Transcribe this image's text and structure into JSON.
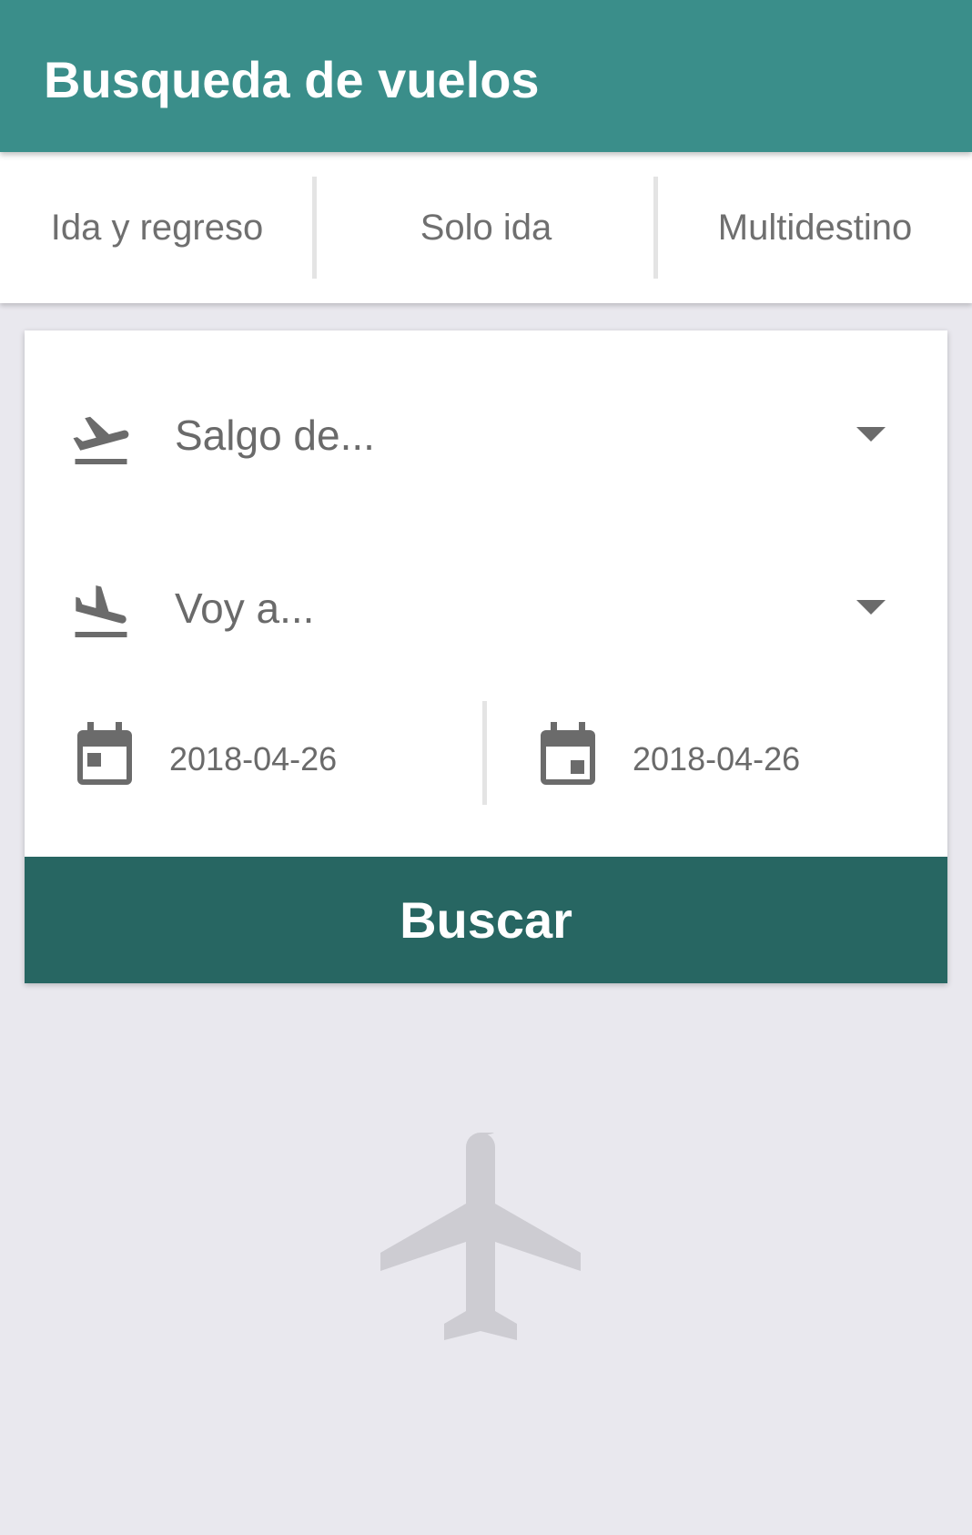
{
  "header": {
    "title": "Busqueda de vuelos"
  },
  "tabs": [
    {
      "label": "Ida y regreso"
    },
    {
      "label": "Solo ida"
    },
    {
      "label": "Multidestino"
    }
  ],
  "form": {
    "origin": {
      "placeholder": "Salgo de...",
      "icon": "flight-takeoff-icon"
    },
    "destination": {
      "placeholder": "Voy a...",
      "icon": "flight-land-icon"
    },
    "departure_date": {
      "value": "2018-04-26",
      "icon": "calendar-icon"
    },
    "return_date": {
      "value": "2018-04-26",
      "icon": "calendar-icon"
    },
    "search_label": "Buscar"
  },
  "background": {
    "icon": "airplane-icon"
  },
  "colors": {
    "app_bar": "#3a8e8a",
    "button": "#276662",
    "background": "#e9e8ee",
    "icon_gray": "#6b6b6b"
  }
}
